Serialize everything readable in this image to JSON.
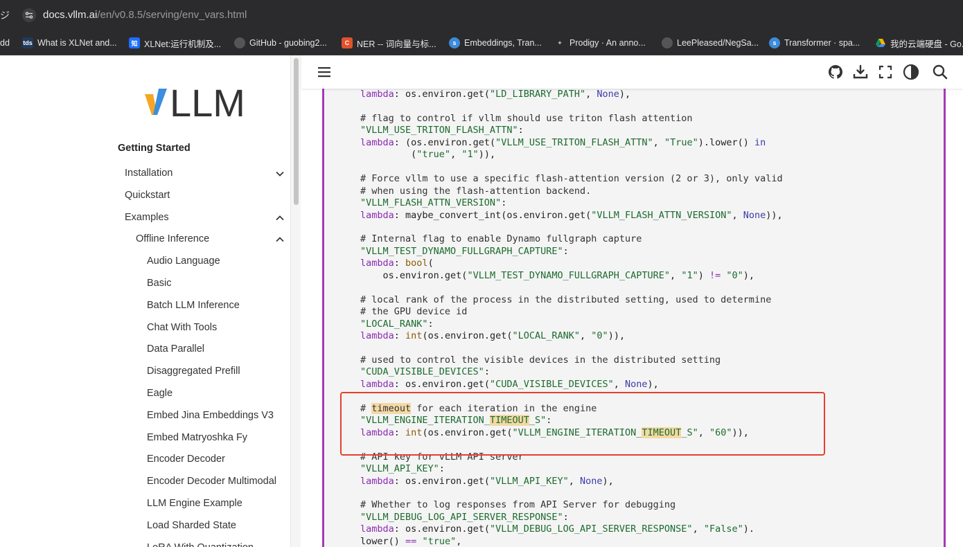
{
  "browser": {
    "edge_glyph": "ジ",
    "url_domain": "docs.vllm.ai",
    "url_path": "/en/v0.8.5/serving/env_vars.html"
  },
  "bookmarks": [
    {
      "label": "dd",
      "icon": "none",
      "color": ""
    },
    {
      "label": "What is XLNet and...",
      "icon": "tds",
      "color": "#1f3b5c"
    },
    {
      "label": "XLNet:运行机制及...",
      "icon": "知",
      "color": "#1e6fff"
    },
    {
      "label": "GitHub - guobing2...",
      "icon": "github-icon",
      "color": "#333"
    },
    {
      "label": "NER -- 词向量与标...",
      "icon": "C",
      "color": "#e2512b"
    },
    {
      "label": "Embeddings, Tran...",
      "icon": "spaCy",
      "color": "#3d8bdb"
    },
    {
      "label": "Prodigy · An anno...",
      "icon": "sparkle-icon",
      "color": "#333"
    },
    {
      "label": "LeePleased/NegSa...",
      "icon": "github-icon",
      "color": "#333"
    },
    {
      "label": "Transformer · spa...",
      "icon": "spaCy",
      "color": "#3d8bdb"
    },
    {
      "label": "我的云端硬盘 - Go...",
      "icon": "drive-icon",
      "color": "#f4b400"
    }
  ],
  "sidebar": {
    "logo_text": "LLM",
    "heading": "Getting Started",
    "items": [
      {
        "label": "Installation",
        "level": 0,
        "chevron": "down"
      },
      {
        "label": "Quickstart",
        "level": 0,
        "chevron": ""
      },
      {
        "label": "Examples",
        "level": 0,
        "chevron": "up"
      },
      {
        "label": "Offline Inference",
        "level": 1,
        "chevron": "up"
      },
      {
        "label": "Audio Language",
        "level": 2,
        "chevron": ""
      },
      {
        "label": "Basic",
        "level": 2,
        "chevron": ""
      },
      {
        "label": "Batch LLM Inference",
        "level": 2,
        "chevron": ""
      },
      {
        "label": "Chat With Tools",
        "level": 2,
        "chevron": ""
      },
      {
        "label": "Data Parallel",
        "level": 2,
        "chevron": ""
      },
      {
        "label": "Disaggregated Prefill",
        "level": 2,
        "chevron": ""
      },
      {
        "label": "Eagle",
        "level": 2,
        "chevron": ""
      },
      {
        "label": "Embed Jina Embeddings V3",
        "level": 2,
        "chevron": ""
      },
      {
        "label": "Embed Matryoshka Fy",
        "level": 2,
        "chevron": ""
      },
      {
        "label": "Encoder Decoder",
        "level": 2,
        "chevron": ""
      },
      {
        "label": "Encoder Decoder Multimodal",
        "level": 2,
        "chevron": ""
      },
      {
        "label": "LLM Engine Example",
        "level": 2,
        "chevron": ""
      },
      {
        "label": "Load Sharded State",
        "level": 2,
        "chevron": ""
      },
      {
        "label": "LoRA With Quantization",
        "level": 2,
        "chevron": ""
      }
    ]
  },
  "topbar_icons": [
    "menu-icon",
    "github-icon",
    "download-icon",
    "fullscreen-icon",
    "theme-toggle-icon",
    "search-icon"
  ],
  "code": {
    "highlight_term": "timeout",
    "lines": [
      [
        [
          "fn",
          "lambda"
        ],
        [
          "t",
          ": os.environ.get("
        ],
        [
          "s",
          "\"LD_LIBRARY_PATH\""
        ],
        [
          "t",
          ", "
        ],
        [
          "k",
          "None"
        ],
        [
          "t",
          "),"
        ]
      ],
      [],
      [
        [
          "c",
          "# flag to control if vllm should use triton flash attention"
        ]
      ],
      [
        [
          "s",
          "\"VLLM_USE_TRITON_FLASH_ATTN\""
        ],
        [
          "t",
          ":"
        ]
      ],
      [
        [
          "fn",
          "lambda"
        ],
        [
          "t",
          ": (os.environ.get("
        ],
        [
          "s",
          "\"VLLM_USE_TRITON_FLASH_ATTN\""
        ],
        [
          "t",
          ", "
        ],
        [
          "s",
          "\"True\""
        ],
        [
          "t",
          ").lower() "
        ],
        [
          "k",
          "in"
        ]
      ],
      [
        [
          "t",
          "         ("
        ],
        [
          "s",
          "\"true\""
        ],
        [
          "t",
          ", "
        ],
        [
          "s",
          "\"1\""
        ],
        [
          "t",
          ")),"
        ]
      ],
      [],
      [
        [
          "c",
          "# Force vllm to use a specific flash-attention version (2 or 3), only valid"
        ]
      ],
      [
        [
          "c",
          "# when using the flash-attention backend."
        ]
      ],
      [
        [
          "s",
          "\"VLLM_FLASH_ATTN_VERSION\""
        ],
        [
          "t",
          ":"
        ]
      ],
      [
        [
          "fn",
          "lambda"
        ],
        [
          "t",
          ": maybe_convert_int(os.environ.get("
        ],
        [
          "s",
          "\"VLLM_FLASH_ATTN_VERSION\""
        ],
        [
          "t",
          ", "
        ],
        [
          "k",
          "None"
        ],
        [
          "t",
          ")),"
        ]
      ],
      [],
      [
        [
          "c",
          "# Internal flag to enable Dynamo fullgraph capture"
        ]
      ],
      [
        [
          "s",
          "\"VLLM_TEST_DYNAMO_FULLGRAPH_CAPTURE\""
        ],
        [
          "t",
          ":"
        ]
      ],
      [
        [
          "fn",
          "lambda"
        ],
        [
          "t",
          ": "
        ],
        [
          "b",
          "bool"
        ],
        [
          "t",
          "("
        ]
      ],
      [
        [
          "t",
          "    os.environ.get("
        ],
        [
          "s",
          "\"VLLM_TEST_DYNAMO_FULLGRAPH_CAPTURE\""
        ],
        [
          "t",
          ", "
        ],
        [
          "s",
          "\"1\""
        ],
        [
          "t",
          ") "
        ],
        [
          "o",
          "!="
        ],
        [
          "t",
          " "
        ],
        [
          "s",
          "\"0\""
        ],
        [
          "t",
          "),"
        ]
      ],
      [],
      [
        [
          "c",
          "# local rank of the process in the distributed setting, used to determine"
        ]
      ],
      [
        [
          "c",
          "# the GPU device id"
        ]
      ],
      [
        [
          "s",
          "\"LOCAL_RANK\""
        ],
        [
          "t",
          ":"
        ]
      ],
      [
        [
          "fn",
          "lambda"
        ],
        [
          "t",
          ": "
        ],
        [
          "b",
          "int"
        ],
        [
          "t",
          "(os.environ.get("
        ],
        [
          "s",
          "\"LOCAL_RANK\""
        ],
        [
          "t",
          ", "
        ],
        [
          "s",
          "\"0\""
        ],
        [
          "t",
          ")),"
        ]
      ],
      [],
      [
        [
          "c",
          "# used to control the visible devices in the distributed setting"
        ]
      ],
      [
        [
          "s",
          "\"CUDA_VISIBLE_DEVICES\""
        ],
        [
          "t",
          ":"
        ]
      ],
      [
        [
          "fn",
          "lambda"
        ],
        [
          "t",
          ": os.environ.get("
        ],
        [
          "s",
          "\"CUDA_VISIBLE_DEVICES\""
        ],
        [
          "t",
          ", "
        ],
        [
          "k",
          "None"
        ],
        [
          "t",
          "),"
        ]
      ],
      [],
      [
        [
          "c",
          "# "
        ],
        [
          "h",
          "timeout"
        ],
        [
          "c",
          " for each iteration in the engine"
        ]
      ],
      [
        [
          "s",
          "\"VLLM_ENGINE_ITERATION_"
        ],
        [
          "hs",
          "TIMEOUT"
        ],
        [
          "s",
          "_S\""
        ],
        [
          "t",
          ":"
        ]
      ],
      [
        [
          "fn",
          "lambda"
        ],
        [
          "t",
          ": "
        ],
        [
          "b",
          "int"
        ],
        [
          "t",
          "(os.environ.get("
        ],
        [
          "s",
          "\"VLLM_ENGINE_ITERATION_"
        ],
        [
          "hs",
          "TIMEOUT"
        ],
        [
          "s",
          "_S\""
        ],
        [
          "t",
          ", "
        ],
        [
          "s",
          "\"60\""
        ],
        [
          "t",
          ")),"
        ]
      ],
      [],
      [
        [
          "c",
          "# API key for vLLM API server"
        ]
      ],
      [
        [
          "s",
          "\"VLLM_API_KEY\""
        ],
        [
          "t",
          ":"
        ]
      ],
      [
        [
          "fn",
          "lambda"
        ],
        [
          "t",
          ": os.environ.get("
        ],
        [
          "s",
          "\"VLLM_API_KEY\""
        ],
        [
          "t",
          ", "
        ],
        [
          "k",
          "None"
        ],
        [
          "t",
          "),"
        ]
      ],
      [],
      [
        [
          "c",
          "# Whether to log responses from API Server for debugging"
        ]
      ],
      [
        [
          "s",
          "\"VLLM_DEBUG_LOG_API_SERVER_RESPONSE\""
        ],
        [
          "t",
          ":"
        ]
      ],
      [
        [
          "fn",
          "lambda"
        ],
        [
          "t",
          ": os.environ.get("
        ],
        [
          "s",
          "\"VLLM_DEBUG_LOG_API_SERVER_RESPONSE\""
        ],
        [
          "t",
          ", "
        ],
        [
          "s",
          "\"False\""
        ],
        [
          "t",
          ")."
        ]
      ],
      [
        [
          "t",
          "lower() "
        ],
        [
          "o",
          "=="
        ],
        [
          "t",
          " "
        ],
        [
          "s",
          "\"true\""
        ],
        [
          "t",
          ","
        ]
      ]
    ]
  }
}
